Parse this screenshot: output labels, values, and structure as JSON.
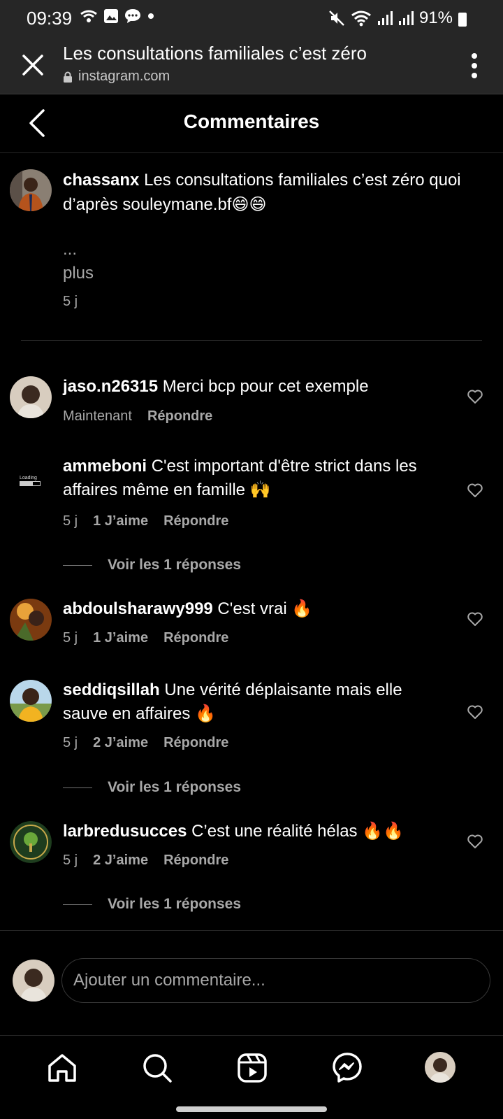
{
  "status": {
    "time": "09:39",
    "battery": "91%",
    "left_icons": [
      "wifi-call-icon",
      "gallery-icon",
      "message-icon",
      "dot-icon"
    ],
    "right_icons": [
      "mute-icon",
      "wifi-icon",
      "signal-icon",
      "signal-icon",
      "battery-icon"
    ]
  },
  "browser": {
    "title": "Les consultations familiales c’est zéro",
    "url": "instagram.com"
  },
  "header": {
    "title": "Commentaires"
  },
  "caption": {
    "username": "chassanx",
    "text": " Les consultations familiales c’est zéro quoi d’après souleymane.bf😄😄",
    "ellipsis": "...",
    "more": "plus",
    "time": "5 j"
  },
  "comments": [
    {
      "username": "jaso.n26315",
      "text": " Merci bcp pour cet exemple",
      "time": "Maintenant",
      "likes": "",
      "reply": "Répondre",
      "replies": ""
    },
    {
      "username": "ammeboni",
      "text": " C'est important d'être strict dans les affaires même en famille 🙌",
      "time": "5 j",
      "likes": "1 J’aime",
      "reply": "Répondre",
      "replies": "Voir les 1 réponses",
      "avatar_text": "Loading"
    },
    {
      "username": "abdoulsharawy999",
      "text": " C'est vrai 🔥",
      "time": "5 j",
      "likes": "1 J’aime",
      "reply": "Répondre",
      "replies": ""
    },
    {
      "username": "seddiqsillah",
      "text": " Une vérité déplaisante mais elle sauve en affaires 🔥",
      "time": "5 j",
      "likes": "2 J’aime",
      "reply": "Répondre",
      "replies": "Voir les 1 réponses"
    },
    {
      "username": "larbredusucces",
      "text": " C’est une réalité hélas 🔥🔥",
      "time": "5 j",
      "likes": "2 J’aime",
      "reply": "Répondre",
      "replies": "Voir les 1 réponses"
    }
  ],
  "composer": {
    "placeholder": "Ajouter un commentaire..."
  },
  "nav": [
    "home-icon",
    "search-icon",
    "reels-icon",
    "messenger-icon",
    "profile-avatar"
  ],
  "colors": {
    "background": "#000000",
    "bar": "#262626",
    "muted": "#a8a8a8"
  }
}
